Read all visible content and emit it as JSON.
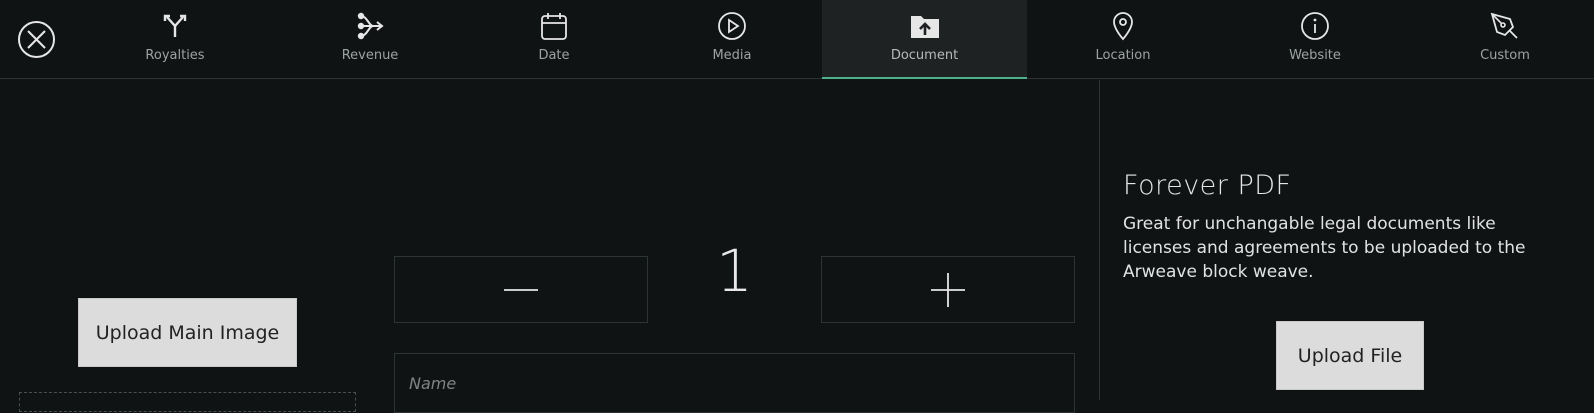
{
  "tabs": [
    {
      "label": "Royalties",
      "icon": "split-arrows-icon"
    },
    {
      "label": "Revenue",
      "icon": "distribution-icon"
    },
    {
      "label": "Date",
      "icon": "calendar-icon"
    },
    {
      "label": "Media",
      "icon": "play-circle-icon"
    },
    {
      "label": "Document",
      "icon": "folder-upload-icon",
      "active": true
    },
    {
      "label": "Location",
      "icon": "map-pin-icon"
    },
    {
      "label": "Website",
      "icon": "info-circle-icon"
    },
    {
      "label": "Custom",
      "icon": "pen-tool-icon"
    }
  ],
  "left": {
    "upload_main_label": "Upload Main Image"
  },
  "stepper": {
    "value": "1",
    "minus_icon": "minus-icon",
    "plus_icon": "plus-icon"
  },
  "name_field": {
    "placeholder": "Name",
    "value": ""
  },
  "info": {
    "title": "Forever PDF",
    "description": "Great for unchangable legal documents like licenses and agreements to be uploaded to the Arweave block weave.",
    "upload_label": "Upload File"
  },
  "colors": {
    "background": "#101314",
    "active_tab_bg": "#1e2223",
    "active_underline": "#4fb08c",
    "button_bg": "#dcdcdc"
  }
}
